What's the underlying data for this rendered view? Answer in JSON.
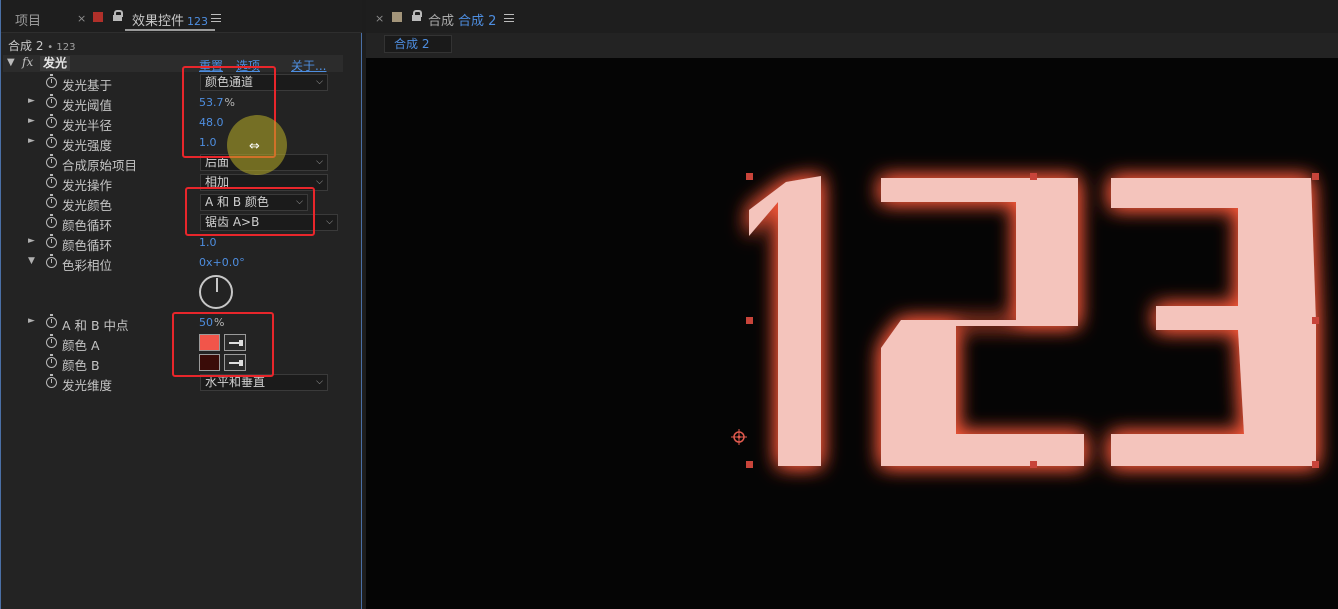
{
  "left_panel": {
    "tab_project": "项目",
    "tab_close": "×",
    "tab_effects": "效果控件",
    "tab_effects_layer": "123",
    "breadcrumb": "合成 2",
    "breadcrumb_layer": "• 123",
    "effect": {
      "fx": "fx",
      "name": "发光",
      "reset": "重置",
      "options": "选项",
      "about": "关于..."
    },
    "properties": [
      {
        "label": "发光基于",
        "dropdown": "颜色通道"
      },
      {
        "label": "发光阈值",
        "value": "53.7",
        "unit": "%"
      },
      {
        "label": "发光半径",
        "value": "48.0"
      },
      {
        "label": "发光强度",
        "value": "1.0"
      },
      {
        "label": "合成原始项目",
        "dropdown": "后面"
      },
      {
        "label": "发光操作",
        "dropdown": "相加"
      },
      {
        "label": "发光颜色",
        "dropdown": "A 和 B 颜色"
      },
      {
        "label": "颜色循环",
        "dropdown": "锯齿 A>B"
      },
      {
        "label": "颜色循环",
        "value": "1.0"
      },
      {
        "label": "色彩相位",
        "value": "0x+0.0°"
      },
      {
        "label": "A 和 B 中点",
        "value": "50",
        "unit": "%"
      },
      {
        "label": "颜色 A",
        "color": "#f2554a"
      },
      {
        "label": "颜色 B",
        "color": "#3a0c08"
      },
      {
        "label": "发光维度",
        "dropdown": "水平和垂直"
      }
    ]
  },
  "right_panel": {
    "tab_close": "×",
    "tab_comp_prefix": "合成",
    "tab_comp_name": "合成 2",
    "sub_tab": "合成 2"
  },
  "viewer": {
    "text": "123",
    "glyph_color": "#f4c4bc",
    "glow_color": "#ff5a3c",
    "handle_color": "#c8443a"
  },
  "colors": {
    "accent": "#4e8ee0",
    "highlight_box": "#e8262b"
  }
}
